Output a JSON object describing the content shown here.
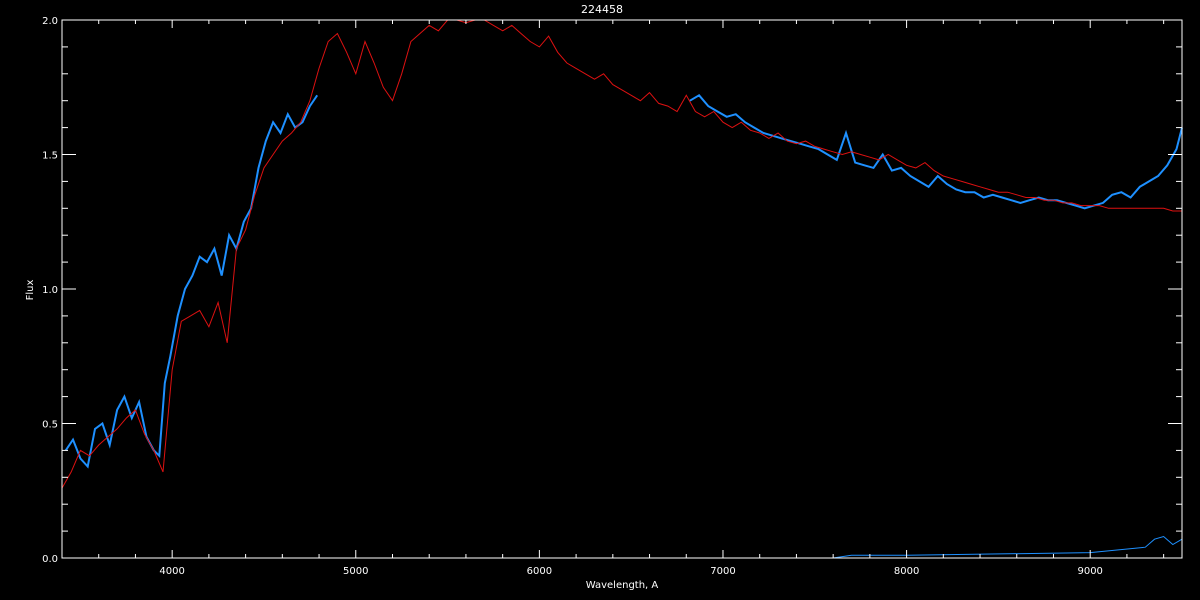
{
  "chart_data": {
    "type": "line",
    "title": "224458",
    "xlabel": "Wavelength, A",
    "ylabel": "Flux",
    "xlim": [
      3400,
      9500
    ],
    "ylim": [
      0.0,
      2.0
    ],
    "x_ticks": [
      {
        "value": 4000,
        "label": "4000"
      },
      {
        "value": 5000,
        "label": "5000"
      },
      {
        "value": 6000,
        "label": "6000"
      },
      {
        "value": 7000,
        "label": "7000"
      },
      {
        "value": 8000,
        "label": "8000"
      },
      {
        "value": 9000,
        "label": "9000"
      }
    ],
    "y_ticks": [
      {
        "value": 0.0,
        "label": "0.0"
      },
      {
        "value": 0.5,
        "label": "0.5"
      },
      {
        "value": 1.0,
        "label": "1.0"
      },
      {
        "value": 1.5,
        "label": "1.5"
      },
      {
        "value": 2.0,
        "label": "2.0"
      }
    ],
    "grid": false,
    "colors": {
      "background": "#000000",
      "axes": "#ffffff",
      "observed": "#1e90ff",
      "model": "#dd1111",
      "observed_alt": "#ffffff"
    },
    "series": [
      {
        "role": "observed",
        "color": "#1e90ff",
        "segments": [
          {
            "x": [
              3420,
              3460,
              3500,
              3540,
              3580,
              3620,
              3660,
              3700,
              3740,
              3780,
              3820,
              3860,
              3900,
              3930,
              3960,
              3990,
              4030,
              4070,
              4110,
              4150,
              4190,
              4230,
              4270,
              4310,
              4350,
              4390,
              4430,
              4470,
              4510,
              4550,
              4590,
              4630,
              4670,
              4710,
              4750,
              4790
            ],
            "y": [
              0.4,
              0.44,
              0.37,
              0.34,
              0.48,
              0.5,
              0.42,
              0.55,
              0.6,
              0.52,
              0.58,
              0.45,
              0.4,
              0.38,
              0.65,
              0.75,
              0.9,
              1.0,
              1.05,
              1.12,
              1.1,
              1.15,
              1.05,
              1.2,
              1.15,
              1.25,
              1.3,
              1.45,
              1.55,
              1.62,
              1.58,
              1.65,
              1.6,
              1.62,
              1.68,
              1.72
            ]
          },
          {
            "x": [
              6820,
              6870,
              6920,
              6970,
              7020,
              7070,
              7120,
              7170,
              7220,
              7270,
              7320,
              7370,
              7420,
              7470,
              7520,
              7570,
              7620,
              7670,
              7720,
              7770,
              7820,
              7870,
              7920,
              7970,
              8020,
              8070,
              8120,
              8170,
              8220,
              8270,
              8320,
              8370,
              8420,
              8470,
              8520,
              8570,
              8620,
              8670,
              8720,
              8770,
              8820,
              8870,
              8920,
              8970,
              9020,
              9070,
              9120,
              9170,
              9220,
              9270,
              9320,
              9370,
              9420,
              9470,
              9500
            ],
            "y": [
              1.7,
              1.72,
              1.68,
              1.66,
              1.64,
              1.65,
              1.62,
              1.6,
              1.58,
              1.57,
              1.56,
              1.55,
              1.54,
              1.53,
              1.52,
              1.5,
              1.48,
              1.58,
              1.47,
              1.46,
              1.45,
              1.5,
              1.44,
              1.45,
              1.42,
              1.4,
              1.38,
              1.42,
              1.39,
              1.37,
              1.36,
              1.36,
              1.34,
              1.35,
              1.34,
              1.33,
              1.32,
              1.33,
              1.34,
              1.33,
              1.33,
              1.32,
              1.31,
              1.3,
              1.31,
              1.32,
              1.35,
              1.36,
              1.34,
              1.38,
              1.4,
              1.42,
              1.46,
              1.52,
              1.6
            ]
          }
        ]
      },
      {
        "role": "model",
        "color": "#dd1111",
        "segments": [
          {
            "x": [
              3400,
              3450,
              3500,
              3550,
              3600,
              3650,
              3700,
              3750,
              3800,
              3850,
              3900,
              3950,
              4000,
              4050,
              4100,
              4150,
              4200,
              4250,
              4300,
              4350,
              4400,
              4450,
              4500,
              4550,
              4600,
              4650,
              4700,
              4750,
              4800,
              4850,
              4900,
              4950,
              5000,
              5050,
              5100,
              5150,
              5200,
              5250,
              5300,
              5350,
              5400,
              5450,
              5500,
              5550,
              5600,
              5650,
              5700,
              5750,
              5800,
              5850,
              5900,
              5950,
              6000,
              6050,
              6100,
              6150,
              6200,
              6250,
              6300,
              6350,
              6400,
              6450,
              6500,
              6550,
              6600,
              6650,
              6700,
              6750,
              6800,
              6850,
              6900,
              6950,
              7000,
              7050,
              7100,
              7150,
              7200,
              7250,
              7300,
              7350,
              7400,
              7450,
              7500,
              7550,
              7600,
              7650,
              7700,
              7750,
              7800,
              7850,
              7900,
              7950,
              8000,
              8050,
              8100,
              8150,
              8200,
              8250,
              8300,
              8350,
              8400,
              8450,
              8500,
              8550,
              8600,
              8650,
              8700,
              8750,
              8800,
              8850,
              8900,
              8950,
              9000,
              9050,
              9100,
              9150,
              9200,
              9250,
              9300,
              9350,
              9400,
              9450,
              9500
            ],
            "y": [
              0.26,
              0.32,
              0.4,
              0.38,
              0.42,
              0.45,
              0.48,
              0.52,
              0.55,
              0.46,
              0.4,
              0.32,
              0.7,
              0.88,
              0.9,
              0.92,
              0.86,
              0.95,
              0.8,
              1.15,
              1.22,
              1.35,
              1.45,
              1.5,
              1.55,
              1.58,
              1.62,
              1.7,
              1.82,
              1.92,
              1.95,
              1.88,
              1.8,
              1.92,
              1.84,
              1.75,
              1.7,
              1.8,
              1.92,
              1.95,
              1.98,
              1.96,
              2.0,
              2.0,
              1.99,
              2.0,
              2.0,
              1.98,
              1.96,
              1.98,
              1.95,
              1.92,
              1.9,
              1.94,
              1.88,
              1.84,
              1.82,
              1.8,
              1.78,
              1.8,
              1.76,
              1.74,
              1.72,
              1.7,
              1.73,
              1.69,
              1.68,
              1.66,
              1.72,
              1.66,
              1.64,
              1.66,
              1.62,
              1.6,
              1.62,
              1.59,
              1.58,
              1.56,
              1.58,
              1.55,
              1.54,
              1.55,
              1.53,
              1.52,
              1.51,
              1.5,
              1.51,
              1.5,
              1.49,
              1.48,
              1.5,
              1.48,
              1.46,
              1.45,
              1.47,
              1.44,
              1.42,
              1.41,
              1.4,
              1.39,
              1.38,
              1.37,
              1.36,
              1.36,
              1.35,
              1.34,
              1.34,
              1.33,
              1.33,
              1.32,
              1.32,
              1.31,
              1.31,
              1.31,
              1.3,
              1.3,
              1.3,
              1.3,
              1.3,
              1.3,
              1.3,
              1.29,
              1.29
            ]
          }
        ]
      },
      {
        "role": "noise",
        "color": "#1e90ff",
        "segments": [
          {
            "x": [
              3400,
              4000,
              4800,
              4900,
              6800,
              7600,
              7700,
              8000,
              9000,
              9300,
              9350,
              9400,
              9450,
              9500
            ],
            "y": [
              0.0,
              0.0,
              0.0,
              0.0,
              0.0,
              0.0,
              0.01,
              0.01,
              0.02,
              0.04,
              0.07,
              0.08,
              0.05,
              0.07
            ]
          }
        ]
      }
    ]
  }
}
